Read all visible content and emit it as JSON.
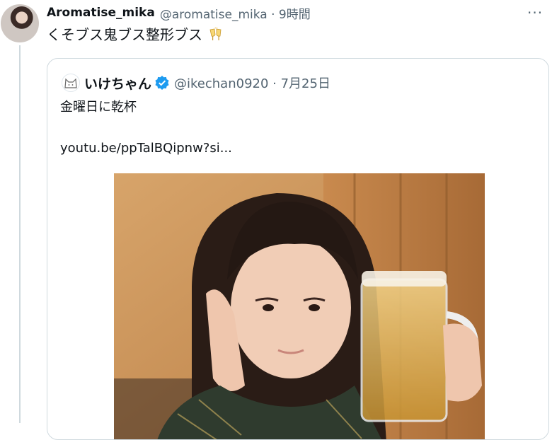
{
  "tweet": {
    "display_name": "Aromatise_mika",
    "meta": "@aromatise_mika · 9時間",
    "text": "くそブス鬼ブス整形ブス"
  },
  "quoted": {
    "display_name": "いけちゃん",
    "meta": "@ikechan0920 · 7月25日",
    "text": "金曜日に乾杯",
    "link": "youtu.be/ppTalBQipnw?si..."
  },
  "icons": {
    "more": "more-icon",
    "verified": "verified-badge-icon",
    "emoji": "clinking-glasses-emoji"
  },
  "colors": {
    "verified_blue": "#1d9bf0",
    "secondary_text": "#536471",
    "border": "#cfd9de"
  }
}
